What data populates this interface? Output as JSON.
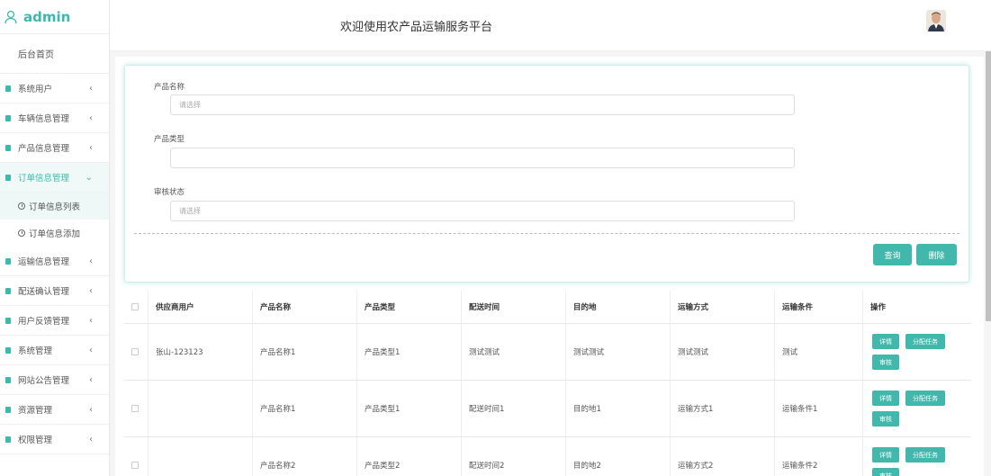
{
  "brand": {
    "text": "admin"
  },
  "header": {
    "title": "欢迎使用农产品运输服务平台"
  },
  "sidebar": {
    "home": "后台首页",
    "items": [
      {
        "label": "系统用户",
        "chev": "‹"
      },
      {
        "label": "车辆信息管理",
        "chev": "‹"
      },
      {
        "label": "产品信息管理",
        "chev": "‹"
      },
      {
        "label": "订单信息管理",
        "chev": "⌄"
      },
      {
        "label": "运输信息管理",
        "chev": "‹"
      },
      {
        "label": "配送确认管理",
        "chev": "‹"
      },
      {
        "label": "用户反馈管理",
        "chev": "‹"
      },
      {
        "label": "系统管理",
        "chev": "‹"
      },
      {
        "label": "网站公告管理",
        "chev": "‹"
      },
      {
        "label": "资源管理",
        "chev": "‹"
      },
      {
        "label": "权限管理",
        "chev": "‹"
      }
    ],
    "subitems": [
      {
        "label": "订单信息列表"
      },
      {
        "label": "订单信息添加"
      }
    ]
  },
  "search": {
    "product_name_label": "产品名称",
    "product_name_placeholder": "请选择",
    "product_type_label": "产品类型",
    "product_type_placeholder": "",
    "review_status_label": "审核状态",
    "review_status_placeholder": "请选择",
    "query_button": "查询",
    "delete_button": "删除"
  },
  "table": {
    "headers": [
      "供应商用户",
      "产品名称",
      "产品类型",
      "配送时间",
      "目的地",
      "运输方式",
      "运输条件",
      "操作"
    ],
    "rows": [
      [
        "张山-123123",
        "产品名称1",
        "产品类型1",
        "测试测试",
        "测试测试",
        "测试测试",
        "测试",
        ""
      ],
      [
        "",
        "产品名称1",
        "产品类型1",
        "配送时间1",
        "目的地1",
        "运输方式1",
        "运输条件1",
        ""
      ],
      [
        "",
        "产品名称2",
        "产品类型2",
        "配送时间2",
        "目的地2",
        "运输方式2",
        "运输条件2",
        ""
      ]
    ],
    "ops": {
      "detail": "详情",
      "assign": "分配任务",
      "review": "审核"
    }
  },
  "colors": {
    "accent": "#3cb9ac"
  }
}
